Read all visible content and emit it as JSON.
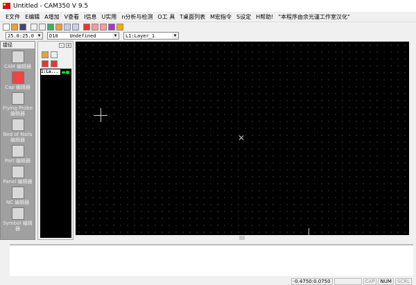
{
  "window": {
    "title": "Untitled - CAM350 V 9.5"
  },
  "menu": [
    "E文件",
    "E编辑",
    "A增加",
    "V查看",
    "I信息",
    "U实用",
    "n分析与检测",
    "O工 具",
    "T桌面列表",
    "M宏指令",
    "S设定",
    "H帮助!",
    "\"本程序由余光谨工作室汉化\""
  ],
  "combos": {
    "grid": "25.0:25.0",
    "dcode": "D10    Undefined",
    "layer": "L1:Layer_1"
  },
  "leftpanel": {
    "header": "捷径",
    "tools": [
      {
        "label": "CAM 编辑器"
      },
      {
        "label": "Cap 编辑器"
      },
      {
        "label": "Flying Probe 编辑器"
      },
      {
        "label": "Bed of Nails 编辑器"
      },
      {
        "label": "Part 编辑器"
      },
      {
        "label": "Panel 编辑器"
      },
      {
        "label": "NC 编辑器"
      },
      {
        "label": "Symbol 编辑器"
      }
    ]
  },
  "layers": [
    {
      "name": "1:La...",
      "color": "#00ff00"
    }
  ],
  "status": {
    "coords": "-0.4750:0.0750",
    "cap": "CAP",
    "num": "NUM",
    "scrl": "SCRL"
  }
}
